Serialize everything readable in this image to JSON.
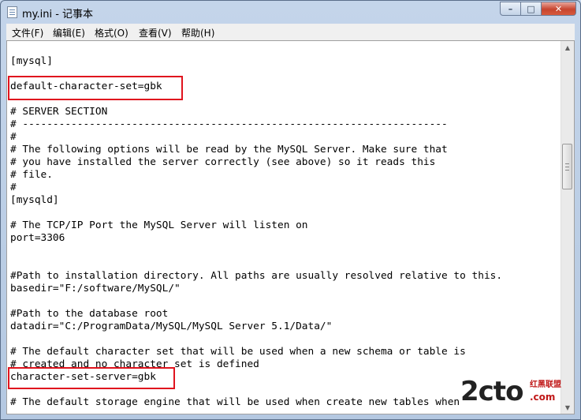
{
  "window": {
    "title": "my.ini - 记事本",
    "controls": {
      "minimize": "–",
      "maximize": "□",
      "close": "✕"
    }
  },
  "menu": [
    "文件(F)",
    "编辑(E)",
    "格式(O)",
    "查看(V)",
    "帮助(H)"
  ],
  "lines": [
    "[mysql]",
    "",
    "default-character-set=gbk",
    "",
    "# SERVER SECTION",
    "# ----------------------------------------------------------------------",
    "#",
    "# The following options will be read by the MySQL Server. Make sure that",
    "# you have installed the server correctly (see above) so it reads this",
    "# file.",
    "#",
    "[mysqld]",
    "",
    "# The TCP/IP Port the MySQL Server will listen on",
    "port=3306",
    "",
    "",
    "#Path to installation directory. All paths are usually resolved relative to this.",
    "basedir=\"F:/software/MySQL/\"",
    "",
    "#Path to the database root",
    "datadir=\"C:/ProgramData/MySQL/MySQL Server 5.1/Data/\"",
    "",
    "# The default character set that will be used when a new schema or table is",
    "# created and no character set is defined",
    "character-set-server=gbk",
    "",
    "# The default storage engine that will be used when create new tables when"
  ],
  "highlights": [
    "default-character-set=gbk",
    "character-set-server=gbk"
  ],
  "watermark": {
    "logo": "2cto",
    "cn_text": "红黑联盟",
    "domain": ".com"
  },
  "scrollbar": {
    "up_icon": "▲",
    "down_icon": "▼"
  },
  "colors": {
    "highlight_border": "#e0141e",
    "watermark_red": "#c01818"
  }
}
